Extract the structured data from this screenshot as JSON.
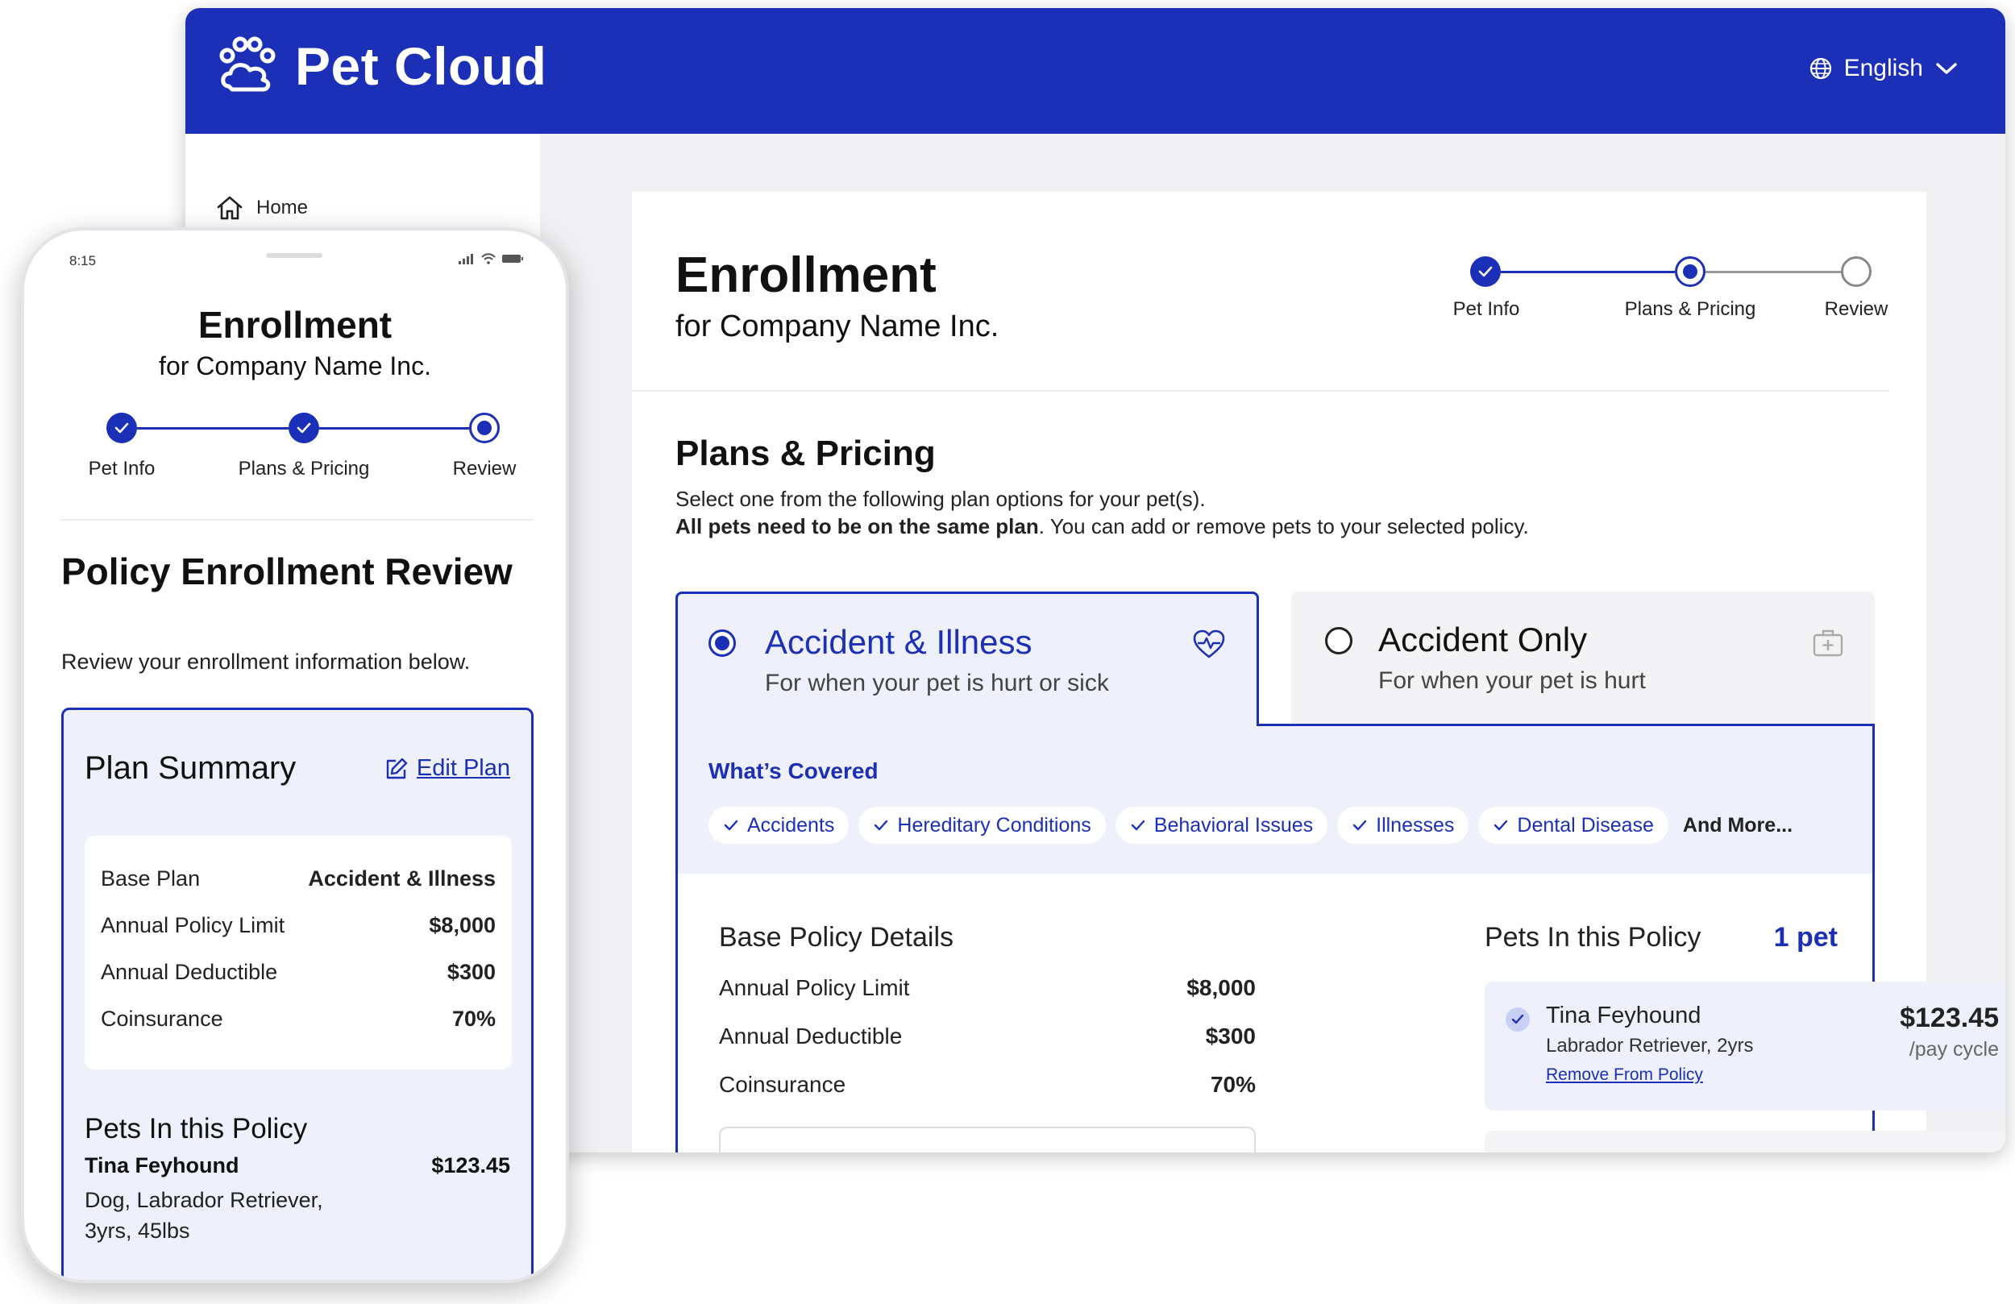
{
  "app": {
    "brand": "Pet Cloud",
    "language": "English"
  },
  "sidebar": {
    "home_label": "Home"
  },
  "enrollment": {
    "title": "Enrollment",
    "subtitle": "for Company Name Inc."
  },
  "desktop_steps": [
    {
      "label": "Pet Info",
      "state": "done"
    },
    {
      "label": "Plans & Pricing",
      "state": "current"
    },
    {
      "label": "Review",
      "state": "todo"
    }
  ],
  "plans": {
    "title": "Plans & Pricing",
    "line1": "Select one from the following plan options for your pet(s).",
    "line2_bold": "All pets need to be on the same plan",
    "line2_rest": ". You can add or remove pets to your selected policy.",
    "options": [
      {
        "title": "Accident & Illness",
        "subtitle": "For when your pet is hurt or sick",
        "selected": true,
        "icon": "heart-pulse-icon"
      },
      {
        "title": "Accident Only",
        "subtitle": "For when your pet is hurt",
        "selected": false,
        "icon": "first-aid-kit-icon"
      }
    ]
  },
  "covered": {
    "title": "What’s Covered",
    "items": [
      "Accidents",
      "Hereditary Conditions",
      "Behavioral Issues",
      "Illnesses",
      "Dental Disease"
    ],
    "more": "And More..."
  },
  "base_policy": {
    "title": "Base Policy Details",
    "rows": [
      {
        "label": "Annual Policy Limit",
        "value": "$8,000"
      },
      {
        "label": "Annual Deductible",
        "value": "$300"
      },
      {
        "label": "Coinsurance",
        "value": "70%"
      }
    ]
  },
  "pets_in_policy": {
    "title": "Pets In this Policy",
    "count": "1 pet",
    "pet": {
      "name": "Tina Feyhound",
      "breed": "Labrador Retriever, 2yrs",
      "remove_label": "Remove From Policy",
      "price": "$123.45",
      "cycle": "/pay cycle"
    }
  },
  "phone": {
    "time": "8:15",
    "steps": [
      {
        "label": "Pet Info",
        "state": "done"
      },
      {
        "label": "Plans & Pricing",
        "state": "done"
      },
      {
        "label": "Review",
        "state": "current"
      }
    ],
    "review_title": "Policy Enrollment Review",
    "review_sub": "Review your enrollment information below.",
    "summary": {
      "title": "Plan Summary",
      "edit_label": "Edit Plan",
      "rows": [
        {
          "label": "Base Plan",
          "value": "Accident & Illness"
        },
        {
          "label": "Annual Policy Limit",
          "value": "$8,000"
        },
        {
          "label": "Annual Deductible",
          "value": "$300"
        },
        {
          "label": "Coinsurance",
          "value": "70%"
        }
      ],
      "pets_title": "Pets In this Policy",
      "pet_name": "Tina Feyhound",
      "pet_price": "$123.45",
      "pet_desc": "Dog, Labrador Retriever, 3yrs, 45lbs"
    }
  },
  "colors": {
    "brand_blue": "#1c2fb7",
    "light_blue": "#eef1fc"
  }
}
